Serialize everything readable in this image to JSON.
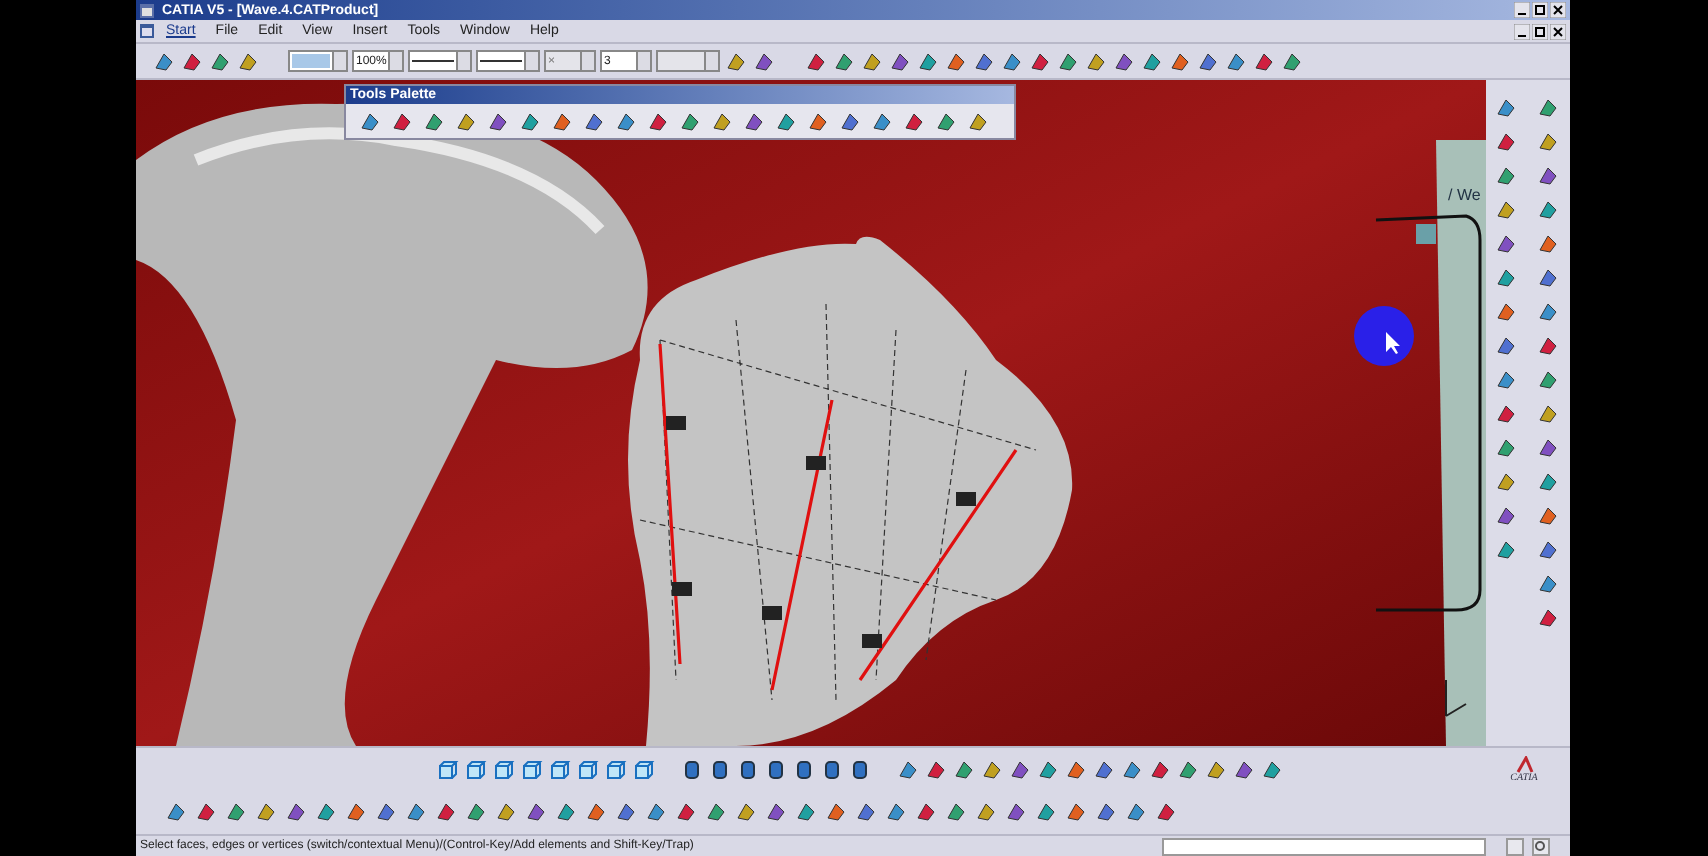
{
  "window": {
    "title": "CATIA V5 - [Wave.4.CATProduct]"
  },
  "menu": [
    {
      "label": "Start",
      "selected": true
    },
    {
      "label": "File",
      "selected": false
    },
    {
      "label": "Edit",
      "selected": false
    },
    {
      "label": "View",
      "selected": false
    },
    {
      "label": "Insert",
      "selected": false
    },
    {
      "label": "Tools",
      "selected": false
    },
    {
      "label": "Window",
      "selected": false
    },
    {
      "label": "Help",
      "selected": false
    }
  ],
  "toolbar": {
    "combos": [
      {
        "kind": "color",
        "disabled": false
      },
      {
        "kind": "text",
        "value": "100%",
        "disabled": false
      },
      {
        "kind": "line",
        "disabled": false
      },
      {
        "kind": "line",
        "disabled": false
      },
      {
        "kind": "text",
        "value": "×",
        "disabled": true
      },
      {
        "kind": "text",
        "value": "3",
        "disabled": false
      },
      {
        "kind": "text",
        "disabled": true
      }
    ]
  },
  "tools_palette": {
    "title": "Tools Palette"
  },
  "viewport": {
    "tree_fragment": "/ We"
  },
  "logo": "CATIA",
  "status_bar": {
    "message": "Select faces, edges or vertices (switch/contextual Menu)/(Control-Key/Add elements and Shift-Key/Trap)"
  }
}
